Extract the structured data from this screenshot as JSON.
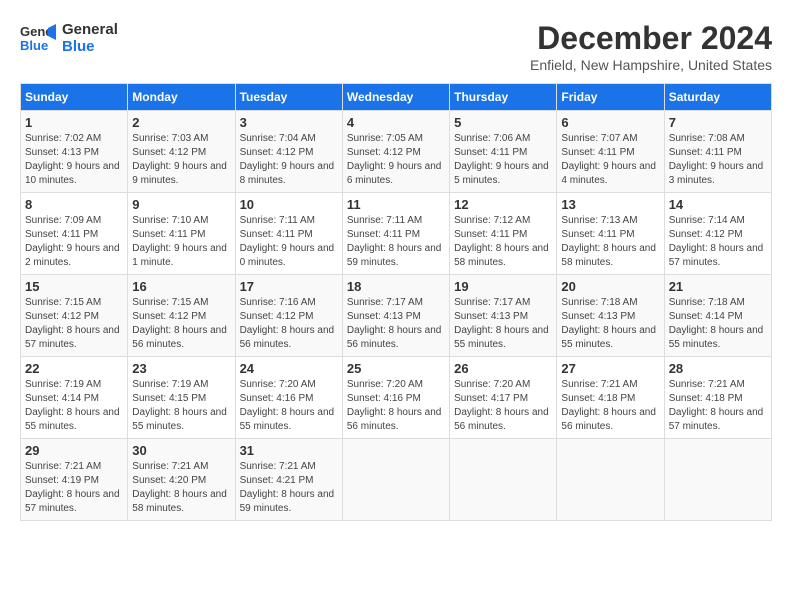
{
  "logo": {
    "line1": "General",
    "line2": "Blue"
  },
  "title": "December 2024",
  "location": "Enfield, New Hampshire, United States",
  "days_header": [
    "Sunday",
    "Monday",
    "Tuesday",
    "Wednesday",
    "Thursday",
    "Friday",
    "Saturday"
  ],
  "weeks": [
    [
      {
        "day": "1",
        "info": "Sunrise: 7:02 AM\nSunset: 4:13 PM\nDaylight: 9 hours and 10 minutes."
      },
      {
        "day": "2",
        "info": "Sunrise: 7:03 AM\nSunset: 4:12 PM\nDaylight: 9 hours and 9 minutes."
      },
      {
        "day": "3",
        "info": "Sunrise: 7:04 AM\nSunset: 4:12 PM\nDaylight: 9 hours and 8 minutes."
      },
      {
        "day": "4",
        "info": "Sunrise: 7:05 AM\nSunset: 4:12 PM\nDaylight: 9 hours and 6 minutes."
      },
      {
        "day": "5",
        "info": "Sunrise: 7:06 AM\nSunset: 4:11 PM\nDaylight: 9 hours and 5 minutes."
      },
      {
        "day": "6",
        "info": "Sunrise: 7:07 AM\nSunset: 4:11 PM\nDaylight: 9 hours and 4 minutes."
      },
      {
        "day": "7",
        "info": "Sunrise: 7:08 AM\nSunset: 4:11 PM\nDaylight: 9 hours and 3 minutes."
      }
    ],
    [
      {
        "day": "8",
        "info": "Sunrise: 7:09 AM\nSunset: 4:11 PM\nDaylight: 9 hours and 2 minutes."
      },
      {
        "day": "9",
        "info": "Sunrise: 7:10 AM\nSunset: 4:11 PM\nDaylight: 9 hours and 1 minute."
      },
      {
        "day": "10",
        "info": "Sunrise: 7:11 AM\nSunset: 4:11 PM\nDaylight: 9 hours and 0 minutes."
      },
      {
        "day": "11",
        "info": "Sunrise: 7:11 AM\nSunset: 4:11 PM\nDaylight: 8 hours and 59 minutes."
      },
      {
        "day": "12",
        "info": "Sunrise: 7:12 AM\nSunset: 4:11 PM\nDaylight: 8 hours and 58 minutes."
      },
      {
        "day": "13",
        "info": "Sunrise: 7:13 AM\nSunset: 4:11 PM\nDaylight: 8 hours and 58 minutes."
      },
      {
        "day": "14",
        "info": "Sunrise: 7:14 AM\nSunset: 4:12 PM\nDaylight: 8 hours and 57 minutes."
      }
    ],
    [
      {
        "day": "15",
        "info": "Sunrise: 7:15 AM\nSunset: 4:12 PM\nDaylight: 8 hours and 57 minutes."
      },
      {
        "day": "16",
        "info": "Sunrise: 7:15 AM\nSunset: 4:12 PM\nDaylight: 8 hours and 56 minutes."
      },
      {
        "day": "17",
        "info": "Sunrise: 7:16 AM\nSunset: 4:12 PM\nDaylight: 8 hours and 56 minutes."
      },
      {
        "day": "18",
        "info": "Sunrise: 7:17 AM\nSunset: 4:13 PM\nDaylight: 8 hours and 56 minutes."
      },
      {
        "day": "19",
        "info": "Sunrise: 7:17 AM\nSunset: 4:13 PM\nDaylight: 8 hours and 55 minutes."
      },
      {
        "day": "20",
        "info": "Sunrise: 7:18 AM\nSunset: 4:13 PM\nDaylight: 8 hours and 55 minutes."
      },
      {
        "day": "21",
        "info": "Sunrise: 7:18 AM\nSunset: 4:14 PM\nDaylight: 8 hours and 55 minutes."
      }
    ],
    [
      {
        "day": "22",
        "info": "Sunrise: 7:19 AM\nSunset: 4:14 PM\nDaylight: 8 hours and 55 minutes."
      },
      {
        "day": "23",
        "info": "Sunrise: 7:19 AM\nSunset: 4:15 PM\nDaylight: 8 hours and 55 minutes."
      },
      {
        "day": "24",
        "info": "Sunrise: 7:20 AM\nSunset: 4:16 PM\nDaylight: 8 hours and 55 minutes."
      },
      {
        "day": "25",
        "info": "Sunrise: 7:20 AM\nSunset: 4:16 PM\nDaylight: 8 hours and 56 minutes."
      },
      {
        "day": "26",
        "info": "Sunrise: 7:20 AM\nSunset: 4:17 PM\nDaylight: 8 hours and 56 minutes."
      },
      {
        "day": "27",
        "info": "Sunrise: 7:21 AM\nSunset: 4:18 PM\nDaylight: 8 hours and 56 minutes."
      },
      {
        "day": "28",
        "info": "Sunrise: 7:21 AM\nSunset: 4:18 PM\nDaylight: 8 hours and 57 minutes."
      }
    ],
    [
      {
        "day": "29",
        "info": "Sunrise: 7:21 AM\nSunset: 4:19 PM\nDaylight: 8 hours and 57 minutes."
      },
      {
        "day": "30",
        "info": "Sunrise: 7:21 AM\nSunset: 4:20 PM\nDaylight: 8 hours and 58 minutes."
      },
      {
        "day": "31",
        "info": "Sunrise: 7:21 AM\nSunset: 4:21 PM\nDaylight: 8 hours and 59 minutes."
      },
      null,
      null,
      null,
      null
    ]
  ]
}
